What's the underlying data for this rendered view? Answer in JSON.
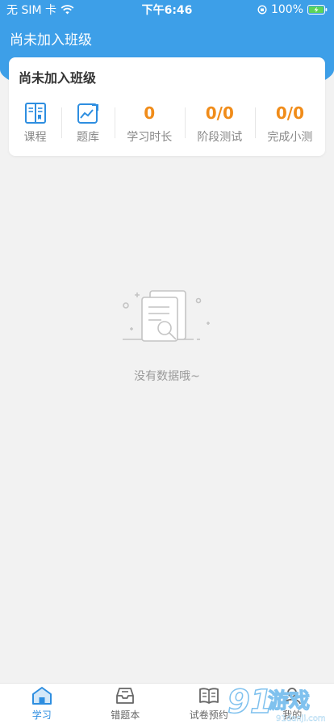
{
  "status_bar": {
    "carrier": "无 SIM 卡",
    "time": "下午6:46",
    "battery": "100%"
  },
  "nav": {
    "title": "尚未加入班级"
  },
  "class_card": {
    "title": "尚未加入班级",
    "items": [
      {
        "kind": "icon",
        "icon": "book-icon",
        "label": "课程"
      },
      {
        "kind": "icon",
        "icon": "chart-edit-icon",
        "label": "题库"
      },
      {
        "kind": "value",
        "value": "0",
        "label": "学习时长"
      },
      {
        "kind": "value",
        "value": "0/0",
        "label": "阶段测试"
      },
      {
        "kind": "value",
        "value": "0/0",
        "label": "完成小测"
      }
    ]
  },
  "empty_state": {
    "message": "没有数据哦~"
  },
  "tab_bar": {
    "tabs": [
      {
        "label": "学习",
        "icon": "home-icon",
        "active": true
      },
      {
        "label": "错题本",
        "icon": "inbox-icon",
        "active": false
      },
      {
        "label": "试卷预约",
        "icon": "open-book-icon",
        "active": false
      },
      {
        "label": "我的",
        "icon": "user-icon",
        "active": false
      }
    ]
  },
  "watermark": {
    "brand": "91游戏",
    "site": "91danji.com"
  },
  "colors": {
    "primary": "#3d9fe8",
    "accent": "#f08c1a",
    "tab_active": "#2e8ee0",
    "background": "#f2f2f2"
  }
}
